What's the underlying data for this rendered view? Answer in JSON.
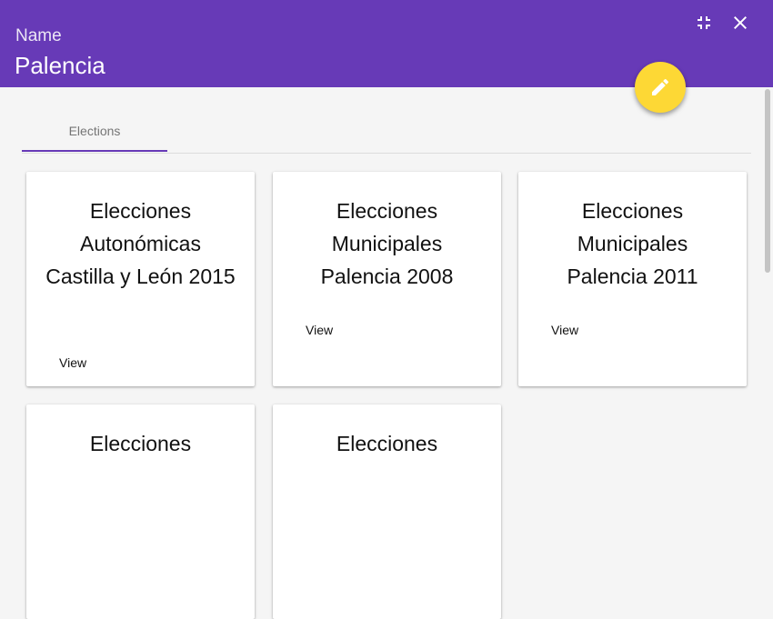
{
  "header": {
    "label": "Name",
    "title": "Palencia",
    "background": "#673ab7",
    "collapse_icon": "fullscreen-exit-icon",
    "close_icon": "close-icon"
  },
  "fab": {
    "icon": "pencil-icon",
    "color": "#fdd835"
  },
  "tabs": [
    {
      "label": "Elections",
      "active": true
    }
  ],
  "cards": [
    {
      "title": "Elecciones Autonómicas Castilla y León 2015",
      "action": "View"
    },
    {
      "title": "Elecciones Municipales Palencia 2008",
      "action": "View"
    },
    {
      "title": "Elecciones Municipales Palencia 2011",
      "action": "View"
    },
    {
      "title": "Elecciones",
      "action": ""
    },
    {
      "title": "Elecciones",
      "action": ""
    }
  ]
}
